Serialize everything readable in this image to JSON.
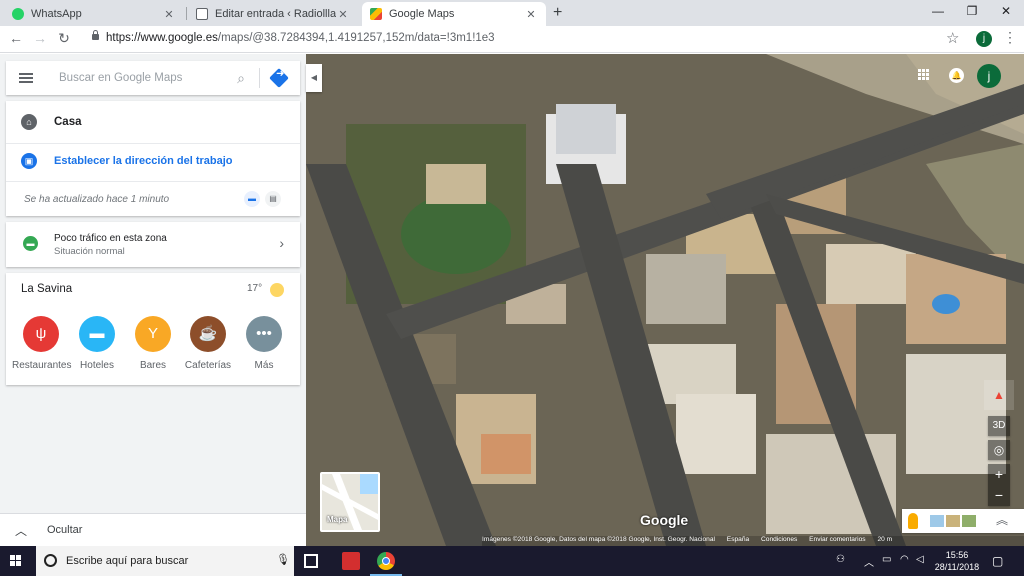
{
  "browser": {
    "tabs": [
      {
        "title": "WhatsApp",
        "favicon": "whatsapp-icon",
        "color": "#25d366"
      },
      {
        "title": "Editar entrada ‹ Radiollla Notícies",
        "favicon": "document-icon",
        "color": "#9aa0a6"
      },
      {
        "title": "Google Maps",
        "favicon": "maps-icon",
        "color": "#4285f4"
      }
    ],
    "url_host": "https://www.google.es",
    "url_path": "/maps/@38.7284394,1.4191257,152m/data=!3m1!1e3",
    "profile_initial": "j"
  },
  "search": {
    "placeholder": "Buscar en Google Maps"
  },
  "places": {
    "home": "Casa",
    "work": "Establecer la dirección del trabajo",
    "updated": "Se ha actualizado hace 1 minuto"
  },
  "traffic": {
    "title": "Poco tráfico en esta zona",
    "status": "Situación normal"
  },
  "explore": {
    "location": "La Savina",
    "temperature": "17°",
    "categories": [
      {
        "label": "Restaurantes",
        "icon": "restaurant-icon",
        "color": "#e53935"
      },
      {
        "label": "Hoteles",
        "icon": "hotel-icon",
        "color": "#29b6f6"
      },
      {
        "label": "Bares",
        "icon": "bar-icon",
        "color": "#f9a825"
      },
      {
        "label": "Cafeterías",
        "icon": "cafe-icon",
        "color": "#8d4e2a"
      },
      {
        "label": "Más",
        "icon": "more-icon",
        "color": "#78909c"
      }
    ]
  },
  "hide_label": "Ocultar",
  "map": {
    "tilt_label": "3D",
    "layer_thumbnail_label": "Mapa",
    "logo": "Google",
    "attribution": [
      "Imágenes ©2018 Google, Datos del mapa ©2018 Google, Inst. Geogr. Nacional",
      "España",
      "Condiciones",
      "Enviar comentarios",
      "20 m"
    ]
  },
  "taskbar": {
    "search_placeholder": "Escribe aquí para buscar",
    "time": "15:56",
    "date": "28/11/2018"
  }
}
